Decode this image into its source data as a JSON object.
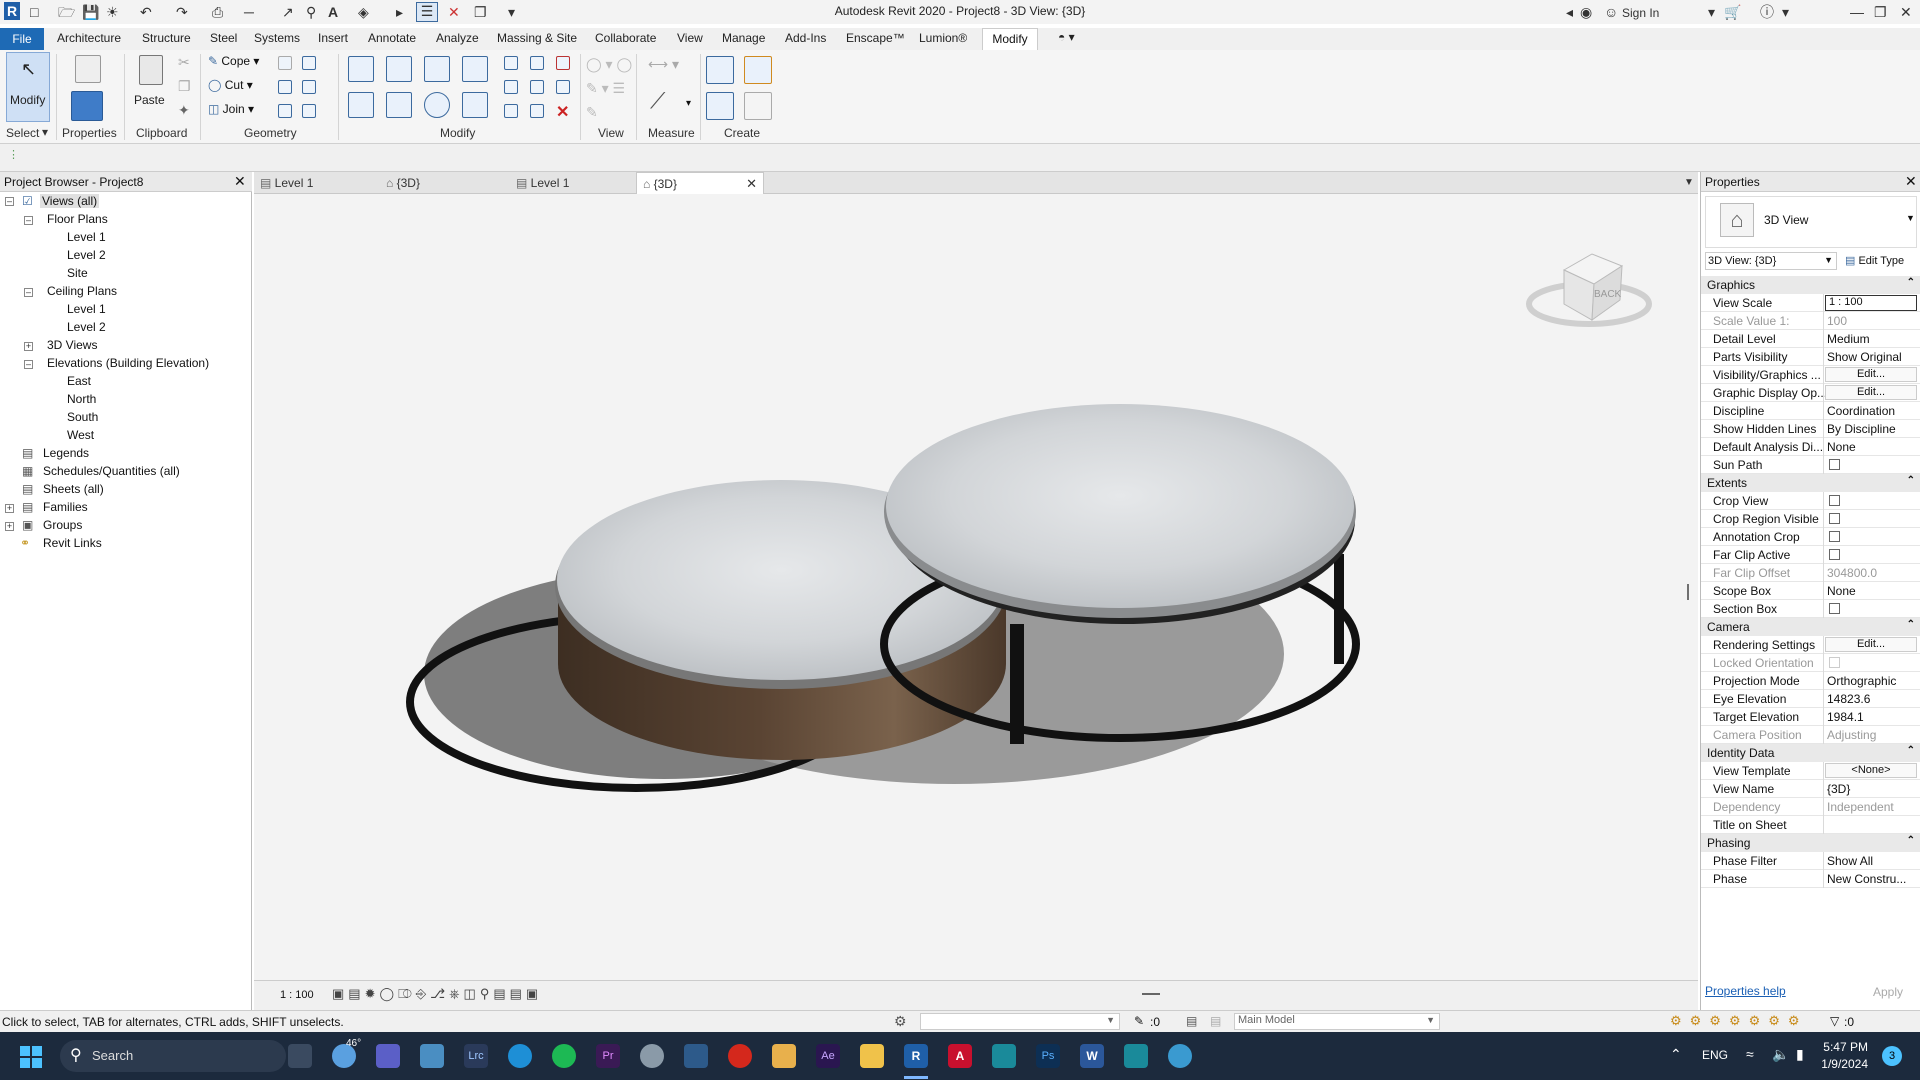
{
  "titlebar": {
    "title": "Autodesk Revit 2020 - Project8 - 3D View: {3D}",
    "sign_in": "Sign In"
  },
  "menu": {
    "file": "File",
    "items": [
      "Architecture",
      "Structure",
      "Steel",
      "Systems",
      "Insert",
      "Annotate",
      "Analyze",
      "Massing & Site",
      "Collaborate",
      "View",
      "Manage",
      "Add-Ins",
      "Enscape™",
      "Lumion®",
      "Modify"
    ]
  },
  "ribbon": {
    "modify": "Modify",
    "paste": "Paste",
    "cope": "Cope",
    "cut": "Cut",
    "join": "Join",
    "panels": {
      "select": "Select",
      "properties": "Properties",
      "clipboard": "Clipboard",
      "geometry": "Geometry",
      "modify": "Modify",
      "view": "View",
      "measure": "Measure",
      "create": "Create"
    }
  },
  "project_browser": {
    "title": "Project Browser - Project8",
    "items": {
      "views_all": "Views (all)",
      "floor_plans": "Floor Plans",
      "fp_level1": "Level 1",
      "fp_level2": "Level 2",
      "fp_site": "Site",
      "ceiling_plans": "Ceiling Plans",
      "cp_level1": "Level 1",
      "cp_level2": "Level 2",
      "views_3d": "3D Views",
      "elevations": "Elevations (Building Elevation)",
      "east": "East",
      "north": "North",
      "south": "South",
      "west": "West",
      "legends": "Legends",
      "schedules": "Schedules/Quantities (all)",
      "sheets": "Sheets (all)",
      "families": "Families",
      "groups": "Groups",
      "revit_links": "Revit Links"
    }
  },
  "view_tabs": [
    {
      "label": "Level 1"
    },
    {
      "label": "{3D}"
    },
    {
      "label": "Level 1"
    },
    {
      "label": "{3D}"
    }
  ],
  "viewcube": {
    "face": "BACK"
  },
  "view_control": {
    "scale": "1 : 100"
  },
  "properties": {
    "title": "Properties",
    "type_name": "3D View",
    "selector": "3D View: {3D}",
    "edit_type": "Edit Type",
    "groups": {
      "graphics": "Graphics",
      "extents": "Extents",
      "camera": "Camera",
      "identity": "Identity Data",
      "phasing": "Phasing"
    },
    "rows": {
      "view_scale": {
        "name": "View Scale",
        "value": "1 : 100"
      },
      "scale_value": {
        "name": "Scale Value    1:",
        "value": "100"
      },
      "detail_level": {
        "name": "Detail Level",
        "value": "Medium"
      },
      "parts_visibility": {
        "name": "Parts Visibility",
        "value": "Show Original"
      },
      "vis_graphics": {
        "name": "Visibility/Graphics ...",
        "value": "Edit..."
      },
      "graphic_display": {
        "name": "Graphic Display Op...",
        "value": "Edit..."
      },
      "discipline": {
        "name": "Discipline",
        "value": "Coordination"
      },
      "hidden_lines": {
        "name": "Show Hidden Lines",
        "value": "By Discipline"
      },
      "default_analysis": {
        "name": "Default Analysis Di...",
        "value": "None"
      },
      "sun_path": {
        "name": "Sun Path"
      },
      "crop_view": {
        "name": "Crop View"
      },
      "crop_region": {
        "name": "Crop Region Visible"
      },
      "annotation_crop": {
        "name": "Annotation Crop"
      },
      "far_clip_active": {
        "name": "Far Clip Active"
      },
      "far_clip_offset": {
        "name": "Far Clip Offset",
        "value": "304800.0"
      },
      "scope_box": {
        "name": "Scope Box",
        "value": "None"
      },
      "section_box": {
        "name": "Section Box"
      },
      "rendering": {
        "name": "Rendering Settings",
        "value": "Edit..."
      },
      "locked_orientation": {
        "name": "Locked Orientation"
      },
      "projection": {
        "name": "Projection Mode",
        "value": "Orthographic"
      },
      "eye_elev": {
        "name": "Eye Elevation",
        "value": "14823.6"
      },
      "target_elev": {
        "name": "Target Elevation",
        "value": "1984.1"
      },
      "camera_pos": {
        "name": "Camera Position",
        "value": "Adjusting"
      },
      "view_template": {
        "name": "View Template",
        "value": "<None>"
      },
      "view_name": {
        "name": "View Name",
        "value": "{3D}"
      },
      "dependency": {
        "name": "Dependency",
        "value": "Independent"
      },
      "title_on_sheet": {
        "name": "Title on Sheet",
        "value": ""
      },
      "phase_filter": {
        "name": "Phase Filter",
        "value": "Show All"
      },
      "phase": {
        "name": "Phase",
        "value": "New Constru..."
      }
    },
    "help": "Properties help",
    "apply": "Apply"
  },
  "status": {
    "hint": "Click to select, TAB for alternates, CTRL adds, SHIFT unselects.",
    "model": "Main Model",
    "sel_count": ":0",
    "filter_count": ":0"
  },
  "taskbar": {
    "search": "Search",
    "temp": "46°",
    "lang": "ENG",
    "time": "5:47 PM",
    "date": "1/9/2024",
    "notif": "3"
  }
}
